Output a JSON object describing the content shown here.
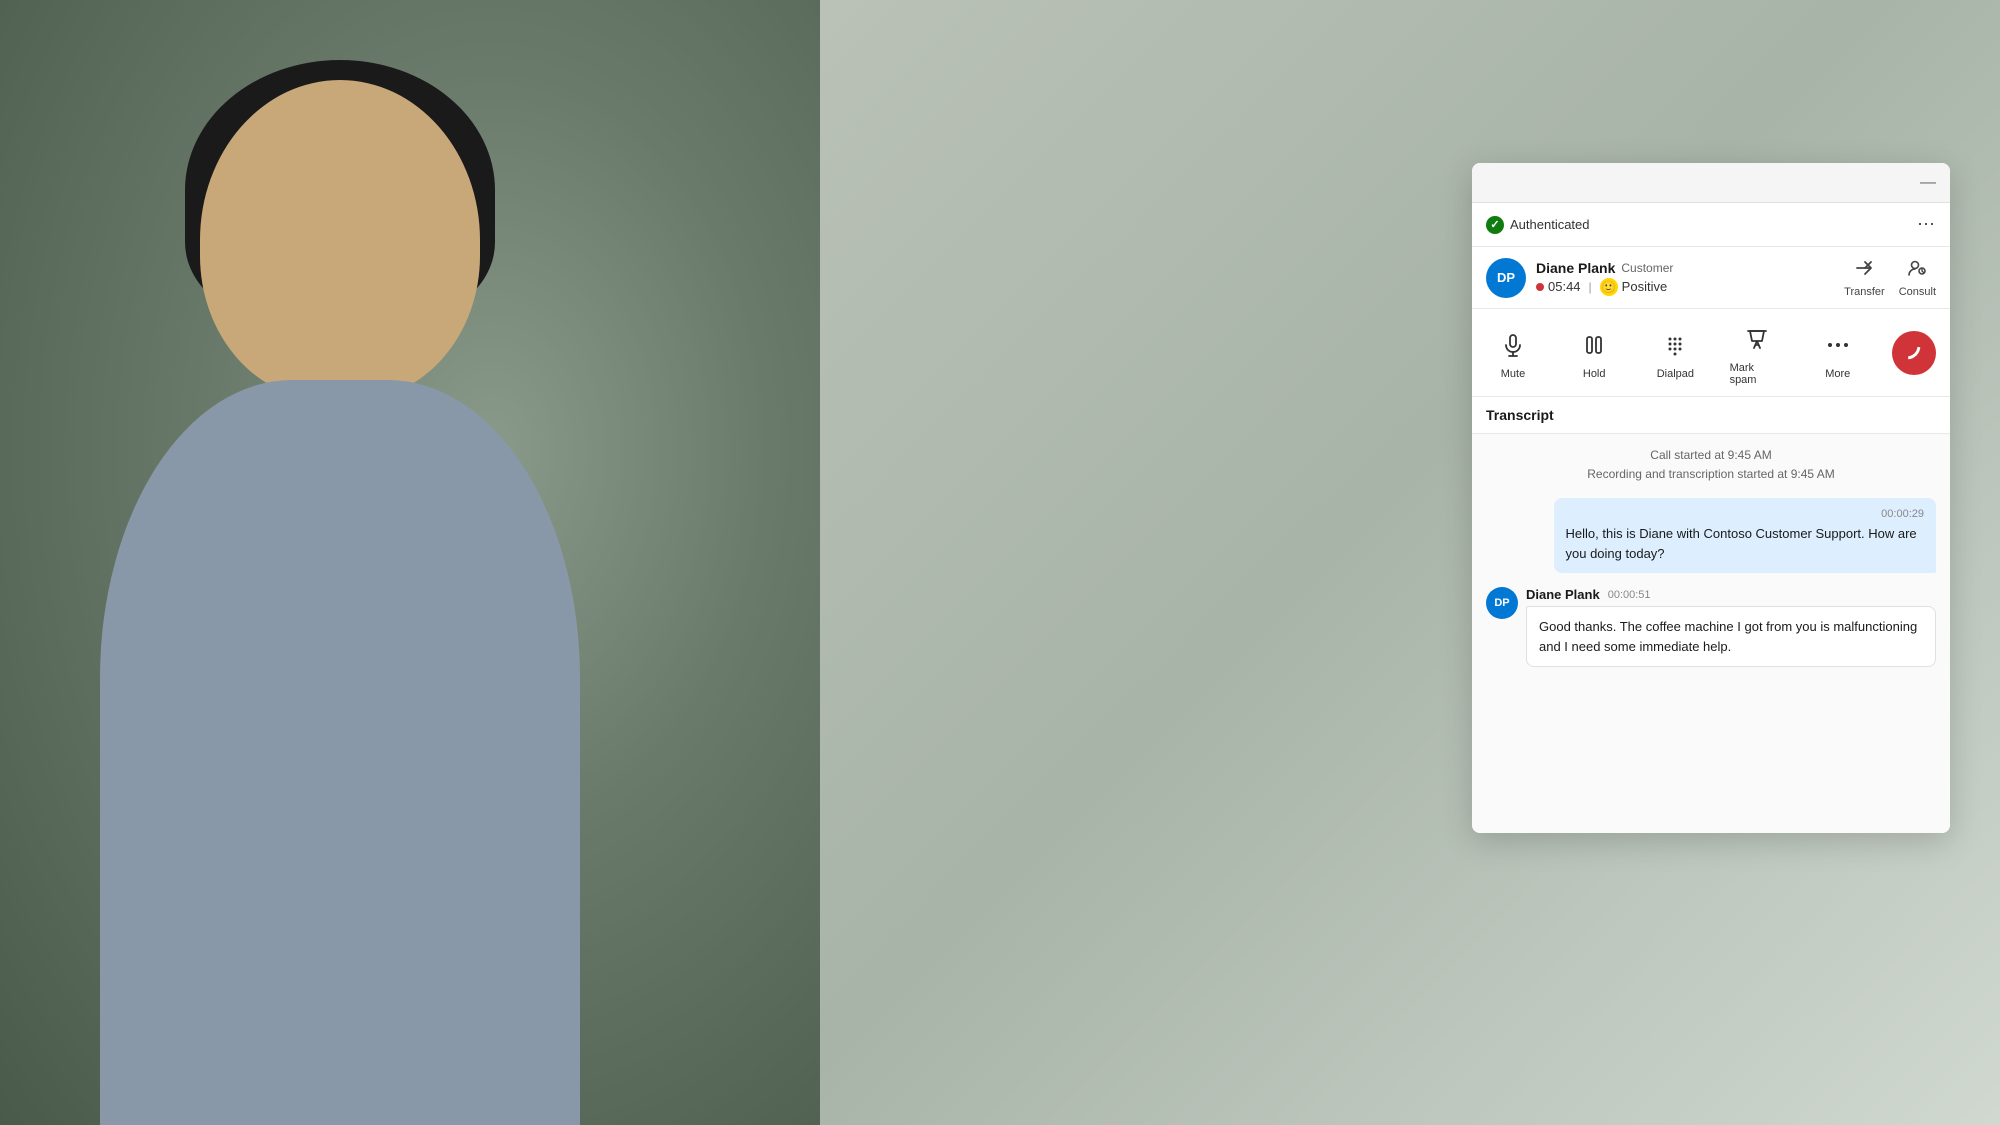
{
  "background": {
    "color_start": "#b8c4b8",
    "color_end": "#a0b0a0"
  },
  "titlebar": {
    "minimize_label": "—"
  },
  "auth": {
    "status": "Authenticated",
    "menu_icon": "⋯"
  },
  "contact": {
    "initials": "DP",
    "name": "Diane Plank",
    "role": "Customer",
    "timer": "05:44",
    "sentiment": "Positive",
    "transfer_label": "Transfer",
    "consult_label": "Consult"
  },
  "controls": {
    "mute_label": "Mute",
    "hold_label": "Hold",
    "dialpad_label": "Dialpad",
    "markspam_label": "Mark spam",
    "more_label": "More",
    "endcall_icon": "📞"
  },
  "transcript": {
    "title": "Transcript",
    "call_started": "Call started at 9:45 AM",
    "recording_started": "Recording and transcription started at 9:45 AM",
    "messages": [
      {
        "type": "agent",
        "timestamp": "00:00:29",
        "text": "Hello, this is Diane with Contoso Customer Support. How are you doing today?"
      },
      {
        "type": "customer",
        "initials": "DP",
        "name": "Diane Plank",
        "timestamp": "00:00:51",
        "text": "Good thanks. The coffee machine I got from you is malfunctioning and I need some immediate help."
      }
    ]
  }
}
